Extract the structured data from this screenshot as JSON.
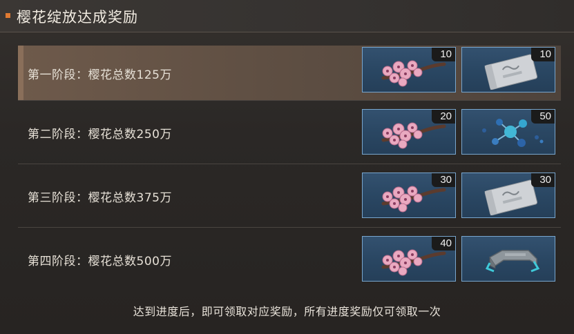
{
  "header": {
    "title": "樱花绽放达成奖励",
    "accent_color": "#e07a32"
  },
  "stages": [
    {
      "label": "第一阶段：樱花总数125万",
      "active": true,
      "rewards": [
        {
          "icon": "cherry-blossom-branch-icon",
          "qty": "10"
        },
        {
          "icon": "sealed-package-icon",
          "qty": "10"
        }
      ]
    },
    {
      "label": "第二阶段：樱花总数250万",
      "active": false,
      "rewards": [
        {
          "icon": "cherry-blossom-branch-icon",
          "qty": "20"
        },
        {
          "icon": "molecule-icon",
          "qty": "50"
        }
      ]
    },
    {
      "label": "第三阶段：樱花总数375万",
      "active": false,
      "rewards": [
        {
          "icon": "cherry-blossom-branch-icon",
          "qty": "30"
        },
        {
          "icon": "sealed-package-icon",
          "qty": "30"
        }
      ]
    },
    {
      "label": "第四阶段：樱花总数500万",
      "active": false,
      "rewards": [
        {
          "icon": "cherry-blossom-branch-icon",
          "qty": "40"
        },
        {
          "icon": "metal-bracket-icon",
          "qty": ""
        }
      ]
    }
  ],
  "footer": {
    "note": "达到进度后，即可领取对应奖励，所有进度奖励仅可领取一次"
  }
}
